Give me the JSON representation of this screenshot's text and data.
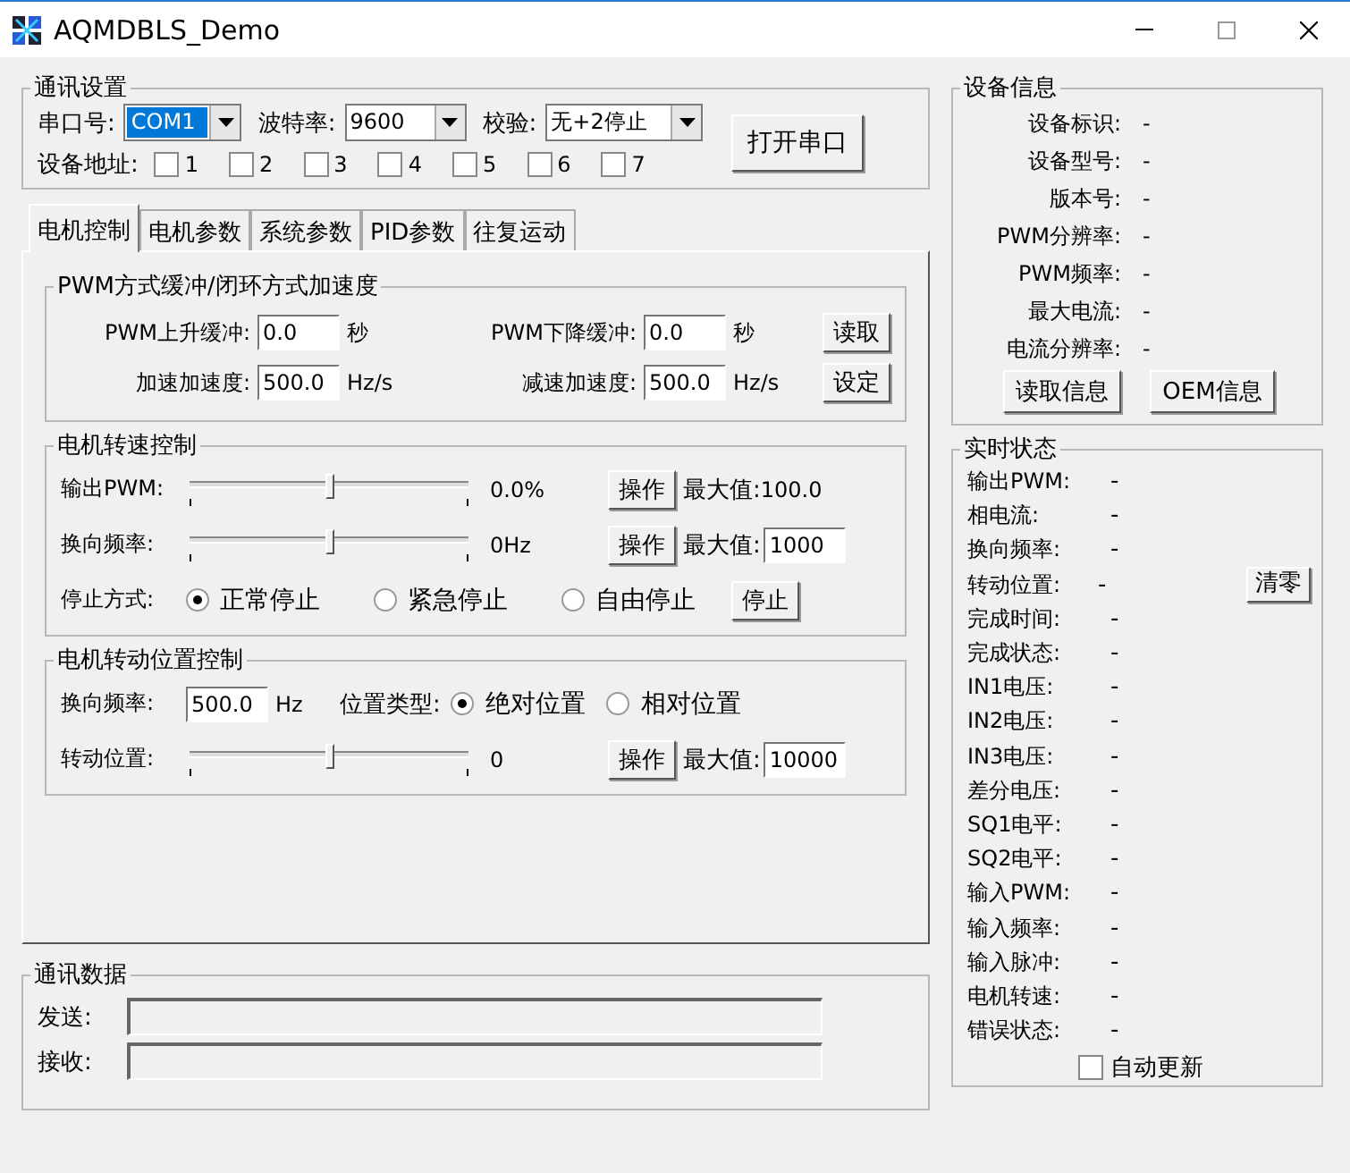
{
  "window": {
    "title": "AQMDBLS_Demo"
  },
  "comm_settings": {
    "title": "通讯设置",
    "combos": [
      {
        "label": "串口号:",
        "value": "COM1",
        "highlighted": true
      },
      {
        "label": "波特率:",
        "value": "9600",
        "highlighted": false
      },
      {
        "label": "校验:",
        "value": "无+2停止",
        "highlighted": false
      }
    ],
    "open_button": "打开串口",
    "address": {
      "label": "设备地址:",
      "checkboxes": [
        {
          "label": "1",
          "checked": false
        },
        {
          "label": "2",
          "checked": false
        },
        {
          "label": "3",
          "checked": false
        },
        {
          "label": "4",
          "checked": false
        },
        {
          "label": "5",
          "checked": false
        },
        {
          "label": "6",
          "checked": false
        },
        {
          "label": "7",
          "checked": false
        }
      ]
    }
  },
  "tabs": [
    {
      "label": "电机控制",
      "selected": true
    },
    {
      "label": "电机参数",
      "selected": false
    },
    {
      "label": "系统参数",
      "selected": false
    },
    {
      "label": "PID参数",
      "selected": false
    },
    {
      "label": "往复运动",
      "selected": false
    }
  ],
  "pwm_group": {
    "title": "PWM方式缓冲/闭环方式加速度",
    "rows": [
      {
        "fields": [
          {
            "label": "PWM上升缓冲:",
            "value": "0.0",
            "unit": "秒"
          },
          {
            "label": "PWM下降缓冲:",
            "value": "0.0",
            "unit": "秒"
          }
        ],
        "button": "读取"
      },
      {
        "fields": [
          {
            "label": "加速加速度:",
            "value": "500.0",
            "unit": "Hz/s"
          },
          {
            "label": "减速加速度:",
            "value": "500.0",
            "unit": "Hz/s"
          }
        ],
        "button": "设定"
      }
    ]
  },
  "speed_group": {
    "title": "电机转速控制",
    "sliders": [
      {
        "label": "输出PWM:",
        "level": 0.5,
        "reading": "0.0%",
        "button": "操作",
        "max_label": "最大值:",
        "max_text": "100.0"
      },
      {
        "label": "换向频率:",
        "level": 0.5,
        "reading": "0Hz",
        "button": "操作",
        "max_label": "最大值:",
        "max_field": "1000"
      }
    ],
    "stop_mode": {
      "label": "停止方式:",
      "options": [
        {
          "label": "正常停止",
          "selected": true
        },
        {
          "label": "紧急停止",
          "selected": false
        },
        {
          "label": "自由停止",
          "selected": false
        }
      ],
      "button": "停止"
    }
  },
  "position_group": {
    "title": "电机转动位置控制",
    "frequency": {
      "label": "换向频率:",
      "value": "500.0",
      "unit": "Hz"
    },
    "position_type": {
      "label": "位置类型:",
      "options": [
        {
          "label": "绝对位置",
          "selected": true
        },
        {
          "label": "相对位置",
          "selected": false
        }
      ]
    },
    "slider": {
      "label": "转动位置:",
      "level": 0.5,
      "reading": "0",
      "button": "操作",
      "max_label": "最大值:",
      "max_field": "10000"
    }
  },
  "comm_data": {
    "title": "通讯数据",
    "fields": [
      {
        "label": "发送:"
      },
      {
        "label": "接收:"
      }
    ]
  },
  "device_info": {
    "title": "设备信息",
    "rows": [
      {
        "label": "设备标识:",
        "value": "-"
      },
      {
        "label": "设备型号:",
        "value": "-"
      },
      {
        "label": "版本号:",
        "value": "-"
      },
      {
        "label": "PWM分辨率:",
        "value": "-"
      },
      {
        "label": "PWM频率:",
        "value": "-"
      },
      {
        "label": "最大电流:",
        "value": "-"
      },
      {
        "label": "电流分辨率:",
        "value": "-"
      }
    ],
    "buttons": [
      "读取信息",
      "OEM信息"
    ]
  },
  "realtime": {
    "title": "实时状态",
    "rows": [
      {
        "label": "输出PWM:",
        "value": "-"
      },
      {
        "label": "相电流:",
        "value": "-"
      },
      {
        "label": "换向频率:",
        "value": "-"
      },
      {
        "label": "转动位置:",
        "value": "-",
        "button": "清零"
      },
      {
        "label": "完成时间:",
        "value": "-"
      },
      {
        "label": "完成状态:",
        "value": "-"
      },
      {
        "label": "IN1电压:",
        "value": "-"
      },
      {
        "label": "IN2电压:",
        "value": "-"
      },
      {
        "label": "IN3电压:",
        "value": "-"
      },
      {
        "label": "差分电压:",
        "value": "-"
      },
      {
        "label": "SQ1电平:",
        "value": "-"
      },
      {
        "label": "SQ2电平:",
        "value": "-"
      },
      {
        "label": "输入PWM:",
        "value": "-"
      },
      {
        "label": "输入频率:",
        "value": "-"
      },
      {
        "label": "输入脉冲:",
        "value": "-"
      },
      {
        "label": "电机转速:",
        "value": "-"
      },
      {
        "label": "错误状态:",
        "value": "-"
      }
    ],
    "auto_update": {
      "label": "自动更新",
      "checked": false
    }
  }
}
